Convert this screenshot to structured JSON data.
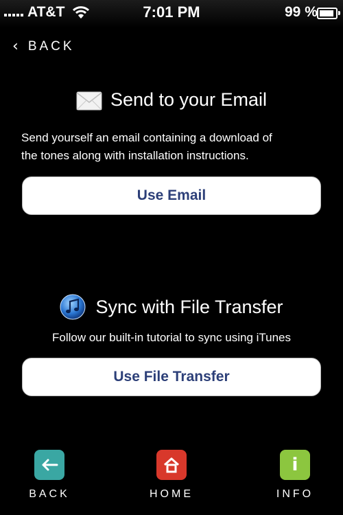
{
  "status": {
    "carrier": "AT&T",
    "time": "7:01 PM",
    "battery": "99 %",
    "battery_level": 0.99
  },
  "back": {
    "label": "BACK",
    "icon": "chevron-left-icon"
  },
  "email_section": {
    "title": "Send to your Email",
    "icon": "envelope-icon",
    "description_line1": "Send yourself an email containing a download of",
    "description_line2": "the tones along with installation instructions.",
    "button_label": "Use Email"
  },
  "transfer_section": {
    "title": "Sync with File Transfer",
    "icon": "itunes-icon",
    "description": "Follow our built-in tutorial to sync using iTunes",
    "button_label": "Use File Transfer"
  },
  "nav": {
    "back": {
      "label": "BACK",
      "color": "#3aa7a3",
      "icon": "arrow-left-icon"
    },
    "home": {
      "label": "HOME",
      "color": "#d8382b",
      "icon": "home-icon"
    },
    "info": {
      "label": "INFO",
      "color": "#8cc63f",
      "icon": "info-icon"
    }
  },
  "colors": {
    "button_text": "#2c3f78",
    "background": "#000000"
  }
}
